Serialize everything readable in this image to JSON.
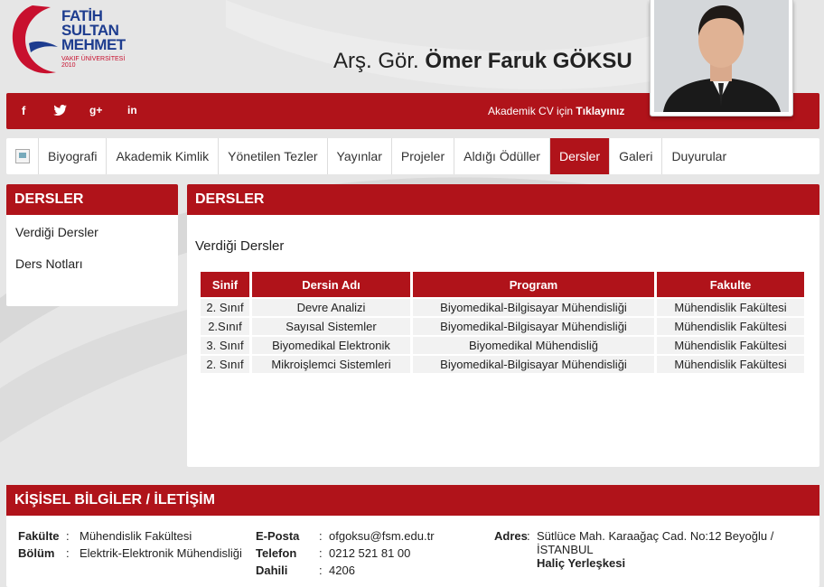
{
  "logo": {
    "line1": "FATİH",
    "line2": "SULTAN",
    "line3": "MEHMET",
    "sub1": "VAKIF ÜNİVERSİTESİ",
    "sub2": "2010"
  },
  "header": {
    "title_prefix": "Arş. Gör.",
    "name": "Ömer Faruk GÖKSU"
  },
  "social": {
    "icons": [
      "facebook-icon",
      "twitter-icon",
      "google-plus-icon",
      "linkedin-icon"
    ],
    "glyphs": [
      "f",
      "🐦",
      "g+",
      "in"
    ],
    "cv_text": "Akademik CV için",
    "cv_link": "Tıklayınız"
  },
  "nav": {
    "items": [
      "Biyografi",
      "Akademik Kimlik",
      "Yönetilen Tezler",
      "Yayınlar",
      "Projeler",
      "Aldığı Ödüller",
      "Dersler",
      "Galeri",
      "Duyurular"
    ],
    "active": "Dersler"
  },
  "side": {
    "title": "DERSLER",
    "items": [
      "Verdiği Dersler",
      "Ders Notları"
    ]
  },
  "main": {
    "title": "DERSLER",
    "subtitle": "Verdiği Dersler",
    "table": {
      "headers": [
        "Sinif",
        "Dersin Adı",
        "Program",
        "Fakulte"
      ],
      "rows": [
        [
          "2. Sınıf",
          "Devre Analizi",
          "Biyomedikal-Bilgisayar Mühendisliği",
          "Mühendislik Fakültesi"
        ],
        [
          "2.Sınıf",
          "Sayısal Sistemler",
          "Biyomedikal-Bilgisayar Mühendisliği",
          "Mühendislik Fakültesi"
        ],
        [
          "3. Sınıf",
          "Biyomedikal Elektronik",
          "Biyomedikal Mühendisliğ",
          "Mühendislik Fakültesi"
        ],
        [
          "2. Sınıf",
          "Mikroişlemci Sistemleri",
          "Biyomedikal-Bilgisayar Mühendisliği",
          "Mühendislik Fakültesi"
        ]
      ]
    }
  },
  "info": {
    "title": "KİŞİSEL BİLGİLER / İLETİŞİM",
    "fakulte_label": "Fakülte",
    "fakulte": "Mühendislik Fakültesi",
    "bolum_label": "Bölüm",
    "bolum": "Elektrik-Elektronik Mühendisliği",
    "eposta_label": "E-Posta",
    "eposta": "ofgoksu@fsm.edu.tr",
    "telefon_label": "Telefon",
    "telefon": "0212 521 81 00",
    "dahili_label": "Dahili",
    "dahili": "4206",
    "adres_label": "Adres",
    "adres_line1": "Sütlüce Mah. Karaağaç Cad. No:12 Beyoğlu /",
    "adres_line2": "İSTANBUL",
    "adres_line3": "Haliç Yerleşkesi",
    "colon": ":"
  },
  "colors": {
    "brand_red": "#b0131a",
    "logo_blue": "#1d3c8f",
    "logo_red": "#c8102e"
  }
}
